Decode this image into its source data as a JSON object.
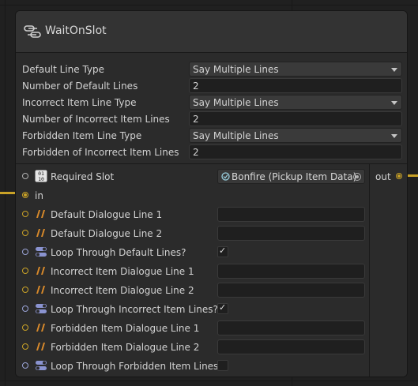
{
  "node": {
    "title": "WaitOnSlot",
    "title_icon": "node-link-icon"
  },
  "settings": [
    {
      "label": "Default Line Type",
      "kind": "dropdown",
      "value": "Say Multiple Lines"
    },
    {
      "label": "Number of Default Lines",
      "kind": "number",
      "value": "2"
    },
    {
      "label": "Incorrect Item Line Type",
      "kind": "dropdown",
      "value": "Say Multiple Lines"
    },
    {
      "label": "Number of Incorrect Item Lines",
      "kind": "number",
      "value": "2"
    },
    {
      "label": "Forbidden Item Line Type",
      "kind": "dropdown",
      "value": "Say Multiple Lines"
    },
    {
      "label": "Forbidden of Incorrect Item Lines",
      "kind": "number",
      "value": "2"
    }
  ],
  "ports": {
    "required_slot": {
      "label": "Required Slot",
      "icon": "binary-icon",
      "value": "Bonfire (Pickup Item Data)",
      "value_icon": "scriptable-object-icon",
      "picker_icon": "object-picker-icon"
    },
    "in": {
      "label": "in"
    },
    "rows": [
      {
        "label": "Default Dialogue Line 1",
        "kind": "string",
        "value": ""
      },
      {
        "label": "Default Dialogue Line 2",
        "kind": "string",
        "value": ""
      },
      {
        "label": "Loop Through Default Lines?",
        "kind": "bool",
        "checked": true
      },
      {
        "label": "Incorrect Item Dialogue Line 1",
        "kind": "string",
        "value": ""
      },
      {
        "label": "Incorrect Item Dialogue Line 2",
        "kind": "string",
        "value": ""
      },
      {
        "label": "Loop Through Incorrect Item Lines?",
        "kind": "bool",
        "checked": true
      },
      {
        "label": "Forbidden Item Dialogue Line 1",
        "kind": "string",
        "value": ""
      },
      {
        "label": "Forbidden Item Dialogue Line 2",
        "kind": "string",
        "value": ""
      },
      {
        "label": "Loop Through Forbidden Item Lines?",
        "kind": "bool",
        "checked": false
      }
    ]
  },
  "outputs": {
    "out_label": "out"
  },
  "colors": {
    "flow": "#c9a227",
    "string_port": "#c9a227",
    "bool_port": "#9aa3d6",
    "background": "#202020",
    "node": "#2b2b2b"
  },
  "icons": {
    "check": "✓",
    "string": "string-quote-icon",
    "bool": "toggle-icon"
  }
}
